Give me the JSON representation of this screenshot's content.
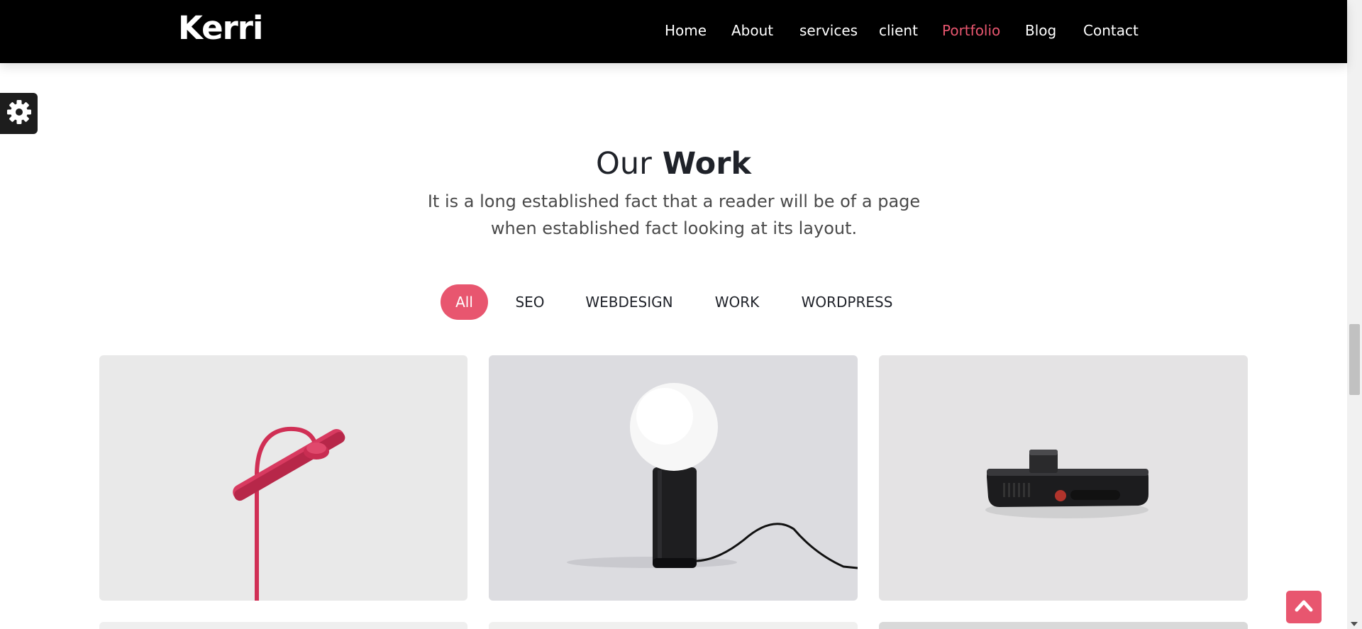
{
  "brand": {
    "logo": "Kerri",
    "accent_color": "#e8566f"
  },
  "nav": {
    "items": [
      {
        "label": "Home",
        "active": false
      },
      {
        "label": "About",
        "active": false
      },
      {
        "label": "services",
        "active": false
      },
      {
        "label": "client",
        "active": false
      },
      {
        "label": "Portfolio",
        "active": true
      },
      {
        "label": "Blog",
        "active": false
      },
      {
        "label": "Contact",
        "active": false
      }
    ]
  },
  "settings": {
    "icon": "gear-icon"
  },
  "work": {
    "title_light": "Our",
    "title_bold": "Work",
    "subtitle": "It is a long established fact that a reader will be of a page when established fact looking at its layout.",
    "filters": [
      {
        "label": "All",
        "active": true
      },
      {
        "label": "SEO",
        "active": false
      },
      {
        "label": "WEBDESIGN",
        "active": false
      },
      {
        "label": "WORK",
        "active": false
      },
      {
        "label": "WORDPRESS",
        "active": false
      }
    ],
    "portfolio": [
      {
        "subject": "red-desk-lamp",
        "background": "#ebebeb"
      },
      {
        "subject": "globe-table-lamp",
        "background": "#dcdce0"
      },
      {
        "subject": "black-camera-device",
        "background": "#e4e3e4"
      }
    ]
  },
  "back_to_top": {
    "icon": "chevron-up-icon"
  }
}
